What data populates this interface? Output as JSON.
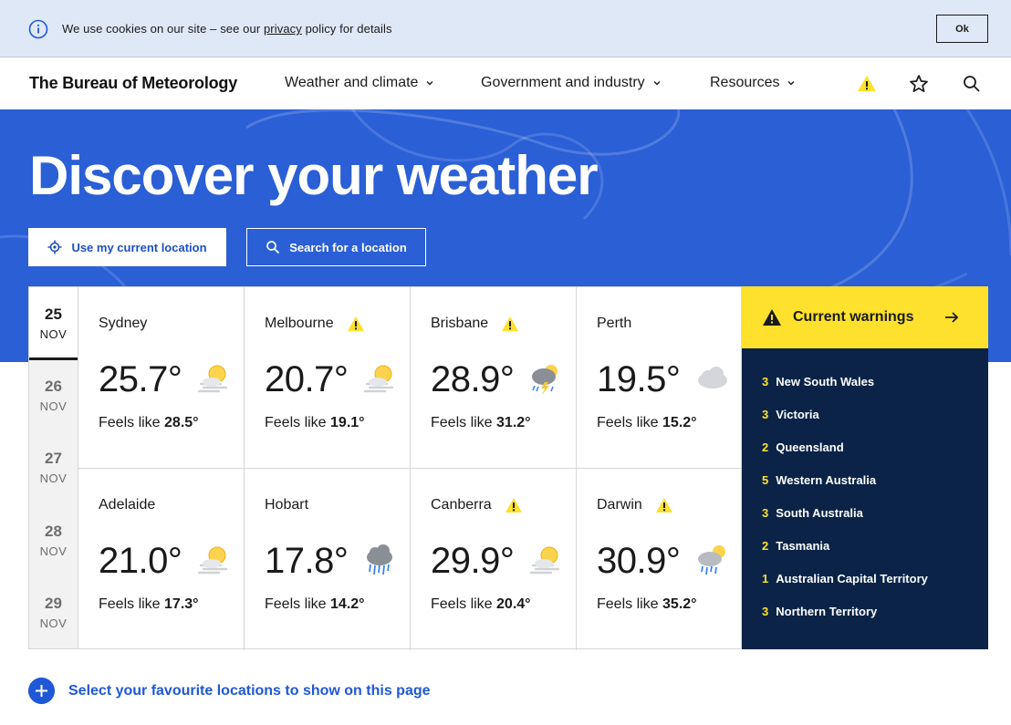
{
  "cookie": {
    "text_before": "We use cookies on our site – see our ",
    "link": "privacy",
    "text_after": " policy for details",
    "ok_label": "Ok"
  },
  "header": {
    "brand": "The Bureau of Meteorology",
    "nav": [
      {
        "label": "Weather and climate"
      },
      {
        "label": "Government and industry"
      },
      {
        "label": "Resources"
      }
    ]
  },
  "hero": {
    "title": "Discover your weather",
    "use_location": "Use my current location",
    "search_location": "Search for a location"
  },
  "dates": [
    {
      "day": "25",
      "month": "NOV"
    },
    {
      "day": "26",
      "month": "NOV"
    },
    {
      "day": "27",
      "month": "NOV"
    },
    {
      "day": "28",
      "month": "NOV"
    },
    {
      "day": "29",
      "month": "NOV"
    }
  ],
  "cities": [
    {
      "name": "Sydney",
      "temp": "25.7°",
      "feels_label": "Feels like ",
      "feels": "28.5°",
      "warning": false,
      "icon": "mostly-sunny-icon"
    },
    {
      "name": "Melbourne",
      "temp": "20.7°",
      "feels_label": "Feels like ",
      "feels": "19.1°",
      "warning": true,
      "icon": "mostly-sunny-icon"
    },
    {
      "name": "Brisbane",
      "temp": "28.9°",
      "feels_label": "Feels like ",
      "feels": "31.2°",
      "warning": true,
      "icon": "storm-icon"
    },
    {
      "name": "Perth",
      "temp": "19.5°",
      "feels_label": "Feels like ",
      "feels": "15.2°",
      "warning": false,
      "icon": "cloudy-icon"
    },
    {
      "name": "Adelaide",
      "temp": "21.0°",
      "feels_label": "Feels like ",
      "feels": "17.3°",
      "warning": false,
      "icon": "mostly-sunny-icon"
    },
    {
      "name": "Hobart",
      "temp": "17.8°",
      "feels_label": "Feels like ",
      "feels": "14.2°",
      "warning": false,
      "icon": "rain-icon"
    },
    {
      "name": "Canberra",
      "temp": "29.9°",
      "feels_label": "Feels like ",
      "feels": "20.4°",
      "warning": true,
      "icon": "mostly-sunny-icon"
    },
    {
      "name": "Darwin",
      "temp": "30.9°",
      "feels_label": "Feels like ",
      "feels": "35.2°",
      "warning": true,
      "icon": "shower-icon"
    }
  ],
  "warnings": {
    "title": "Current warnings",
    "items": [
      {
        "count": "3",
        "state": "New South Wales"
      },
      {
        "count": "3",
        "state": "Victoria"
      },
      {
        "count": "2",
        "state": "Queensland"
      },
      {
        "count": "5",
        "state": "Western Australia"
      },
      {
        "count": "3",
        "state": "South Australia"
      },
      {
        "count": "2",
        "state": "Tasmania"
      },
      {
        "count": "1",
        "state": "Australian Capital Territory"
      },
      {
        "count": "3",
        "state": "Northern Territory"
      }
    ]
  },
  "favourites": {
    "label": "Select your favourite locations to show on this page"
  },
  "colors": {
    "hero": "#2a5fd6",
    "warning_yellow": "#fde12d",
    "navy": "#0a2347",
    "link_blue": "#1f58d6"
  }
}
